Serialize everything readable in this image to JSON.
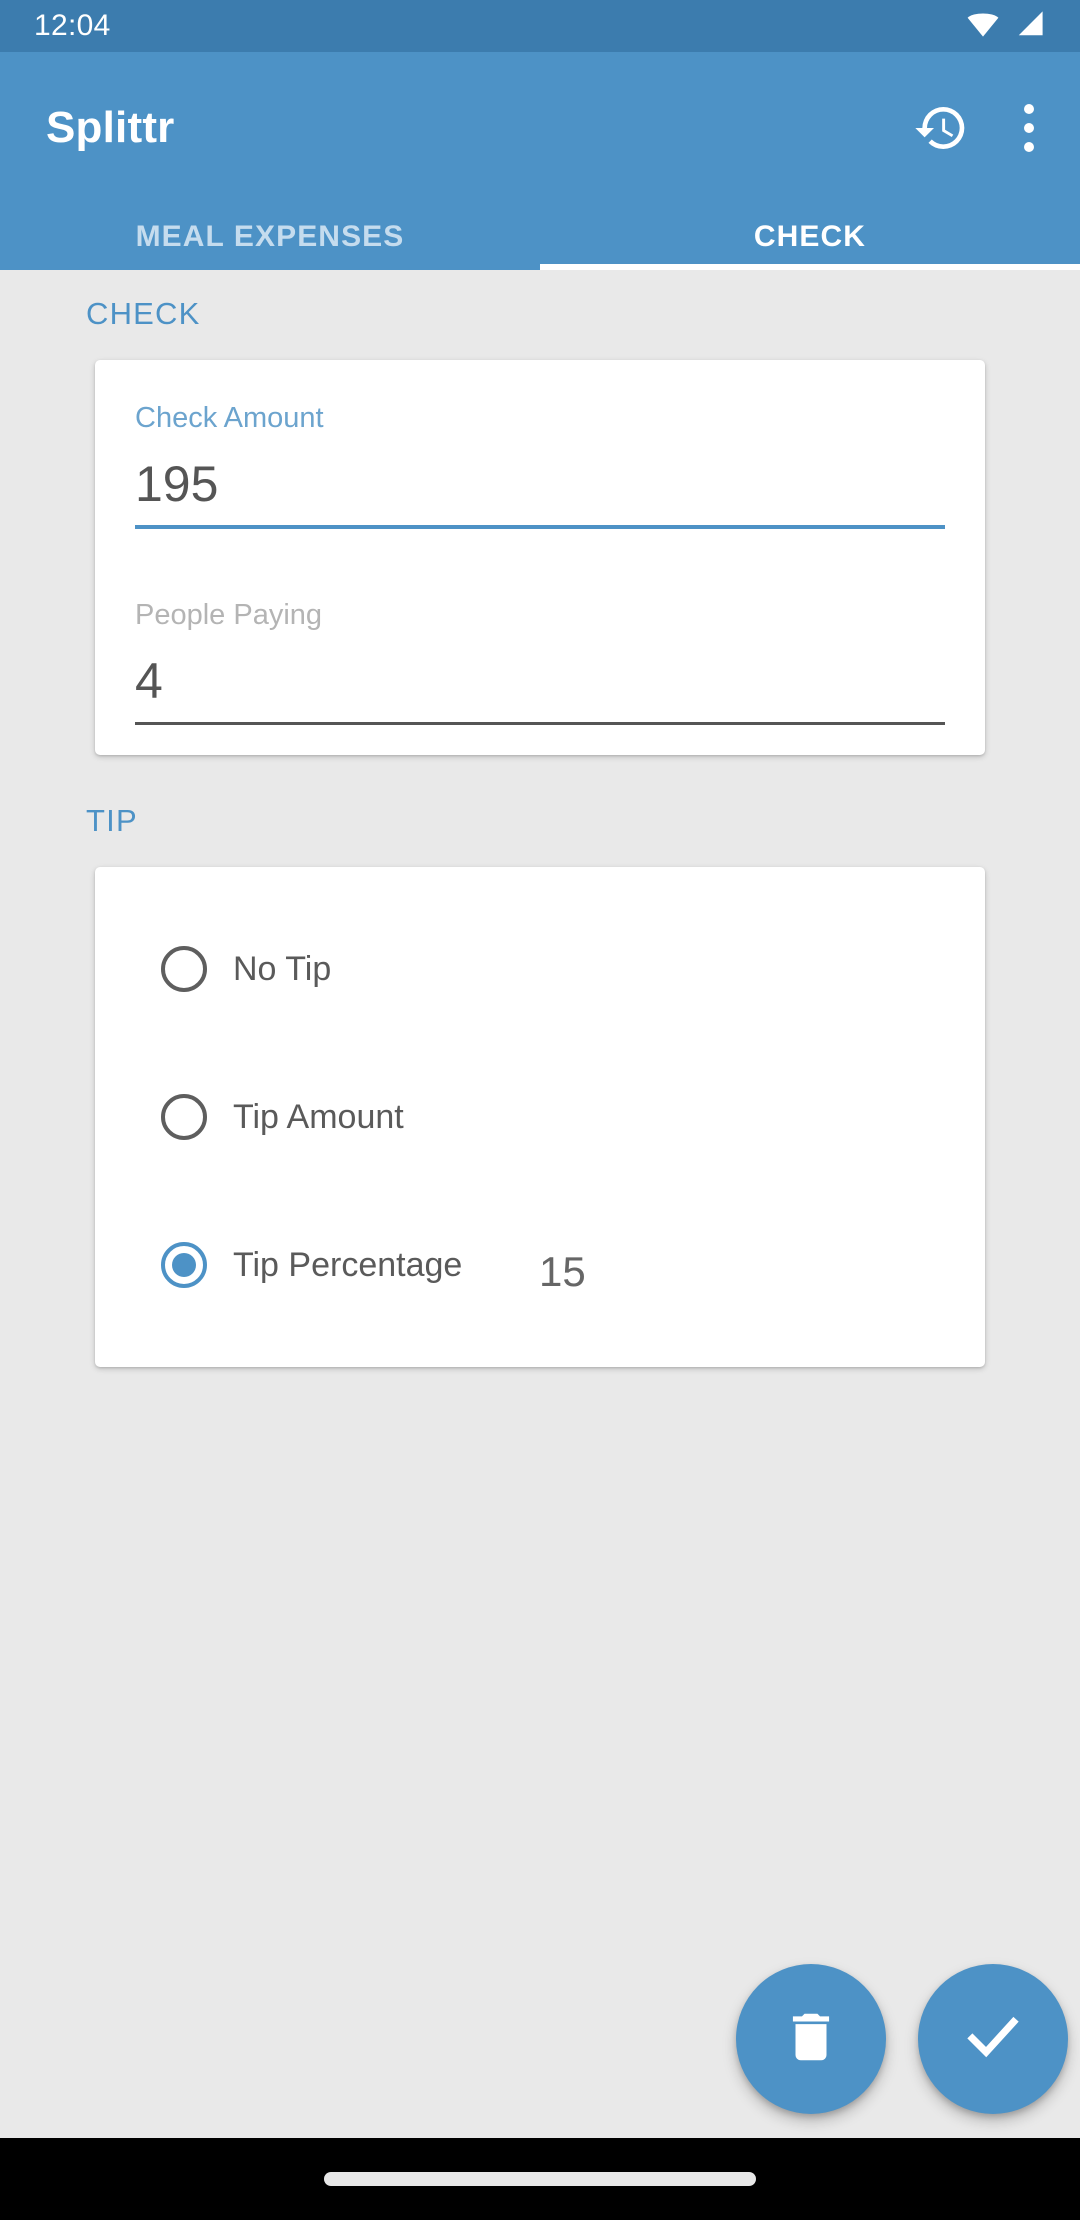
{
  "status_bar": {
    "time": "12:04",
    "icons": [
      "wifi-icon",
      "cellular-signal-icon"
    ]
  },
  "app_bar": {
    "title": "Splittr",
    "actions": [
      {
        "name": "history-icon",
        "label": "History"
      },
      {
        "name": "overflow-menu-icon",
        "label": "More options"
      }
    ]
  },
  "tabs": [
    {
      "label": "MEAL EXPENSES",
      "active": false
    },
    {
      "label": "CHECK",
      "active": true
    }
  ],
  "check_section": {
    "heading": "CHECK",
    "fields": [
      {
        "label": "Check Amount",
        "value": "195",
        "placeholder": "Check Amount",
        "focused": true
      },
      {
        "label": "People Paying",
        "value": "4",
        "placeholder": "People Paying",
        "focused": false
      }
    ]
  },
  "tip_section": {
    "heading": "TIP",
    "options": [
      {
        "label": "No Tip",
        "selected": false,
        "has_input": false,
        "value": "",
        "placeholder": ""
      },
      {
        "label": "Tip Amount",
        "selected": false,
        "has_input": true,
        "value": "",
        "placeholder": ""
      },
      {
        "label": "Tip Percentage",
        "selected": true,
        "has_input": true,
        "value": "15",
        "placeholder": ""
      }
    ]
  },
  "fabs": [
    {
      "name": "delete-fab",
      "icon": "trash-icon",
      "label": "Delete"
    },
    {
      "name": "confirm-fab",
      "icon": "check-icon",
      "label": "Confirm"
    }
  ],
  "nav_bar": {
    "gesture_handle": "home-gesture-pill"
  },
  "colors": {
    "primary": "#4D92C6",
    "status_bar": "#3C7CAE",
    "background": "#E9E9E9",
    "card": "#FFFFFF",
    "accent_text": "#4D92C6",
    "label_inactive": "#B4B4B4",
    "value_text": "#555555",
    "nav_bar": "#000000"
  }
}
